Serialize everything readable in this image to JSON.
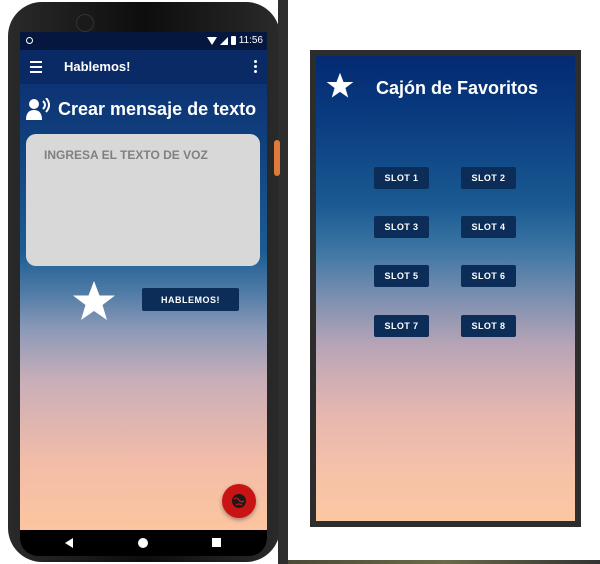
{
  "phone": {
    "status_time": "11:56",
    "app_title": "Hablemos!",
    "header": {
      "title": "Crear mensaje de texto",
      "icon": "speaking-person-icon"
    },
    "text_input": {
      "placeholder": "INGRESA EL TEXTO DE VOZ",
      "value": ""
    },
    "favorite_icon": "star-icon",
    "speak_button_label": "HABLEMOS!",
    "fab_icon": "globe-icon",
    "nav_icons": [
      "back-icon",
      "home-icon",
      "recents-icon"
    ]
  },
  "drawer": {
    "title": "Cajón de Favoritos",
    "icon": "star-icon",
    "slots": [
      "SLOT 1",
      "SLOT 2",
      "SLOT 3",
      "SLOT 4",
      "SLOT 5",
      "SLOT 6",
      "SLOT 7",
      "SLOT 8"
    ]
  },
  "colors": {
    "button_bg": "#0b2d57",
    "fab_bg": "#c81414",
    "input_bg": "#d8d8d8"
  }
}
